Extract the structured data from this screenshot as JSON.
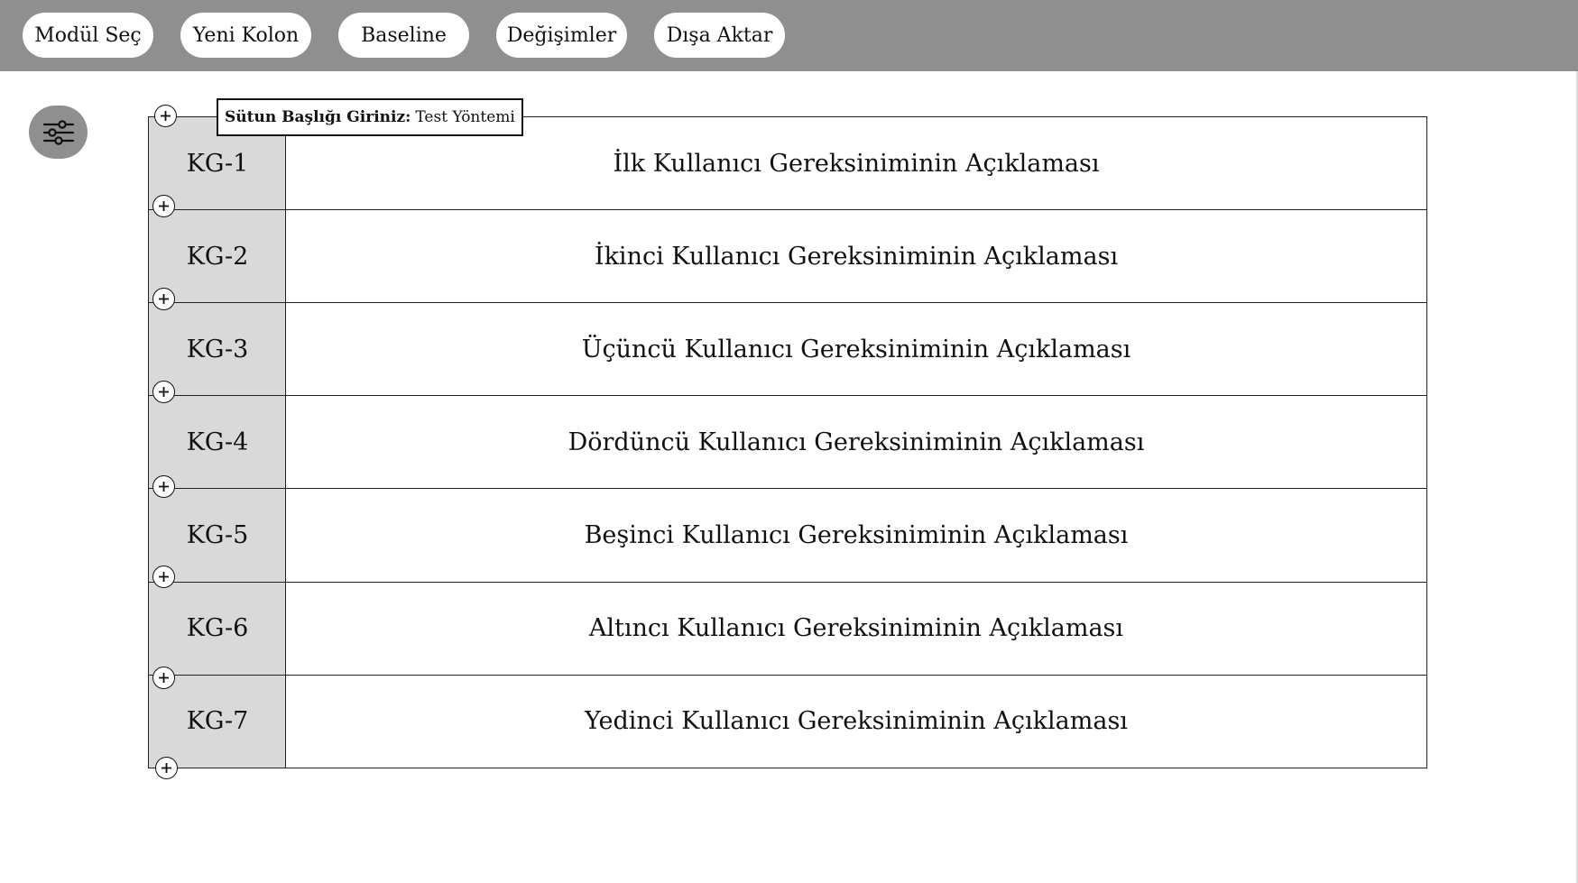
{
  "toolbar": {
    "buttons": [
      {
        "label": "Modül Seç"
      },
      {
        "label": "Yeni Kolon"
      },
      {
        "label": "Baseline"
      },
      {
        "label": "Değişimler"
      },
      {
        "label": "Dışa Aktar"
      }
    ]
  },
  "tooltip": {
    "prompt_label": "Sütun Başlığı Giriniz:",
    "value": "Test Yöntemi"
  },
  "rows": [
    {
      "id": "KG-1",
      "description": "İlk Kullanıcı Gereksiniminin Açıklaması"
    },
    {
      "id": "KG-2",
      "description": "İkinci Kullanıcı Gereksiniminin Açıklaması"
    },
    {
      "id": "KG-3",
      "description": "Üçüncü Kullanıcı Gereksiniminin Açıklaması"
    },
    {
      "id": "KG-4",
      "description": "Dördüncü Kullanıcı Gereksiniminin Açıklaması"
    },
    {
      "id": "KG-5",
      "description": "Beşinci Kullanıcı Gereksiniminin Açıklaması"
    },
    {
      "id": "KG-6",
      "description": "Altıncı Kullanıcı Gereksiniminin Açıklaması"
    },
    {
      "id": "KG-7",
      "description": "Yedinci Kullanıcı Gereksiniminin Açıklaması"
    }
  ],
  "icons": {
    "settings": "sliders-icon",
    "add": "plus-circle-icon"
  },
  "colors": {
    "toolbar_bg": "#8f8f8f",
    "id_column_bg": "#d9d9d9"
  }
}
